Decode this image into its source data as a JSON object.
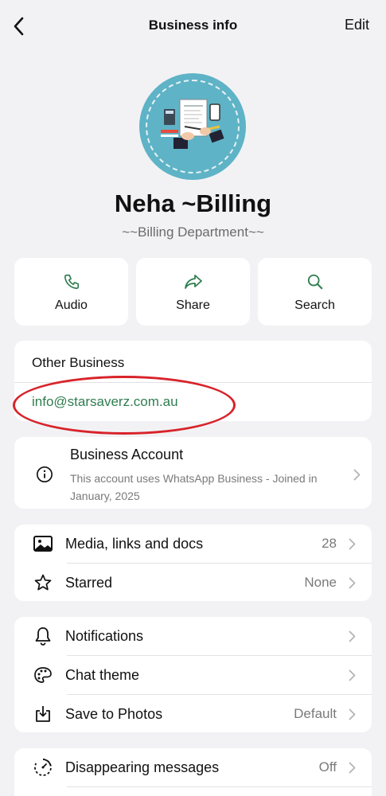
{
  "header": {
    "title": "Business info",
    "edit_label": "Edit"
  },
  "profile": {
    "name": "Neha ~Billing",
    "subtitle": "~~Billing Department~~"
  },
  "actions": [
    {
      "label": "Audio",
      "icon": "phone-icon"
    },
    {
      "label": "Share",
      "icon": "share-arrow-icon"
    },
    {
      "label": "Search",
      "icon": "search-icon"
    }
  ],
  "other_business": {
    "title": "Other Business",
    "email": "info@starsaverz.com.au"
  },
  "business_account": {
    "title": "Business Account",
    "description": "This account uses WhatsApp Business - Joined in January, 2025"
  },
  "media_section": [
    {
      "label": "Media, links and docs",
      "value": "28",
      "icon": "image-icon"
    },
    {
      "label": "Starred",
      "value": "None",
      "icon": "star-icon"
    }
  ],
  "settings_section": [
    {
      "label": "Notifications",
      "value": "",
      "icon": "bell-icon"
    },
    {
      "label": "Chat theme",
      "value": "",
      "icon": "palette-icon"
    },
    {
      "label": "Save to Photos",
      "value": "Default",
      "icon": "save-download-icon"
    }
  ],
  "privacy_section": [
    {
      "label": "Disappearing messages",
      "value": "Off",
      "icon": "timer-icon"
    }
  ],
  "colors": {
    "accent_green": "#2f7d4f",
    "background": "#f2f2f4",
    "annotation_red": "#d8232a",
    "avatar_blue": "#5fb3c6"
  }
}
